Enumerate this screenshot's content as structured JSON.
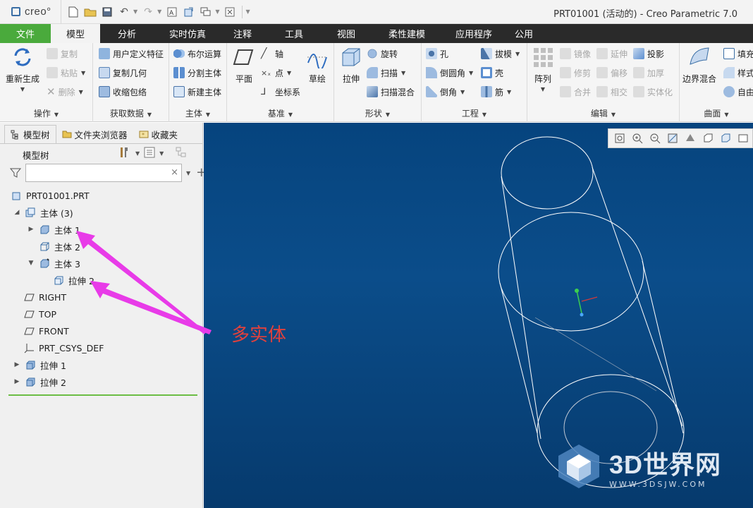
{
  "app": {
    "logo": "creo°",
    "window_title": "PRT01001 (活动的) - Creo Parametric 7.0"
  },
  "tabs": [
    "文件",
    "模型",
    "分析",
    "实时仿真",
    "注释",
    "工具",
    "视图",
    "柔性建模",
    "应用程序",
    "公用"
  ],
  "ribbon": {
    "ops": {
      "regen": "重新生成",
      "copy": "复制",
      "paste": "粘贴",
      "delete": "删除",
      "label": "操作"
    },
    "getdata": {
      "udf": "用户定义特征",
      "copygeom": "复制几何",
      "shrinkwrap": "收缩包络",
      "label": "获取数据"
    },
    "body": {
      "boolean": "布尔运算",
      "split": "分割主体",
      "newbody": "新建主体",
      "label": "主体"
    },
    "datum": {
      "plane": "平面",
      "axis": "轴",
      "point": "点",
      "csys": "坐标系",
      "sketch": "草绘",
      "label": "基准"
    },
    "shape": {
      "extrude": "拉伸",
      "revolve": "旋转",
      "sweep": "扫描",
      "sweepblend": "扫描混合",
      "label": "形状"
    },
    "eng": {
      "hole": "孔",
      "draft": "拔模",
      "round": "倒圆角",
      "shell": "壳",
      "chamfer": "倒角",
      "rib": "筋",
      "label": "工程"
    },
    "edit": {
      "pattern": "阵列",
      "mirror": "镜像",
      "extend": "延伸",
      "project": "投影",
      "trim": "修剪",
      "offset": "偏移",
      "thicken": "加厚",
      "merge": "合并",
      "intersect": "相交",
      "solidify": "实体化",
      "label": "编辑"
    },
    "surface": {
      "boundary": "边界混合",
      "fill": "填充",
      "style": "样式",
      "freestyle": "自由",
      "label": "曲面"
    }
  },
  "panel": {
    "tabs": [
      "模型树",
      "文件夹浏览器",
      "收藏夹"
    ],
    "header": "模型树",
    "search_placeholder": "",
    "tree": [
      {
        "label": "PRT01001.PRT"
      },
      {
        "label": "主体 (3)"
      },
      {
        "label": "主体 1"
      },
      {
        "label": "主体 2"
      },
      {
        "label": "主体 3"
      },
      {
        "label": "拉伸 2"
      },
      {
        "label": "RIGHT"
      },
      {
        "label": "TOP"
      },
      {
        "label": "FRONT"
      },
      {
        "label": "PRT_CSYS_DEF"
      },
      {
        "label": "拉伸 1"
      },
      {
        "label": "拉伸 2"
      }
    ]
  },
  "annotation": "多实体",
  "watermark": {
    "brand": "3D世界网",
    "url": "WWW.3DSJW.COM"
  },
  "colors": {
    "file_tab": "#4aaa3c",
    "tab_bar": "#2a2a2a",
    "viewport_top": "#06447e",
    "annotation": "#e1413c",
    "arrow": "#e83be8"
  }
}
